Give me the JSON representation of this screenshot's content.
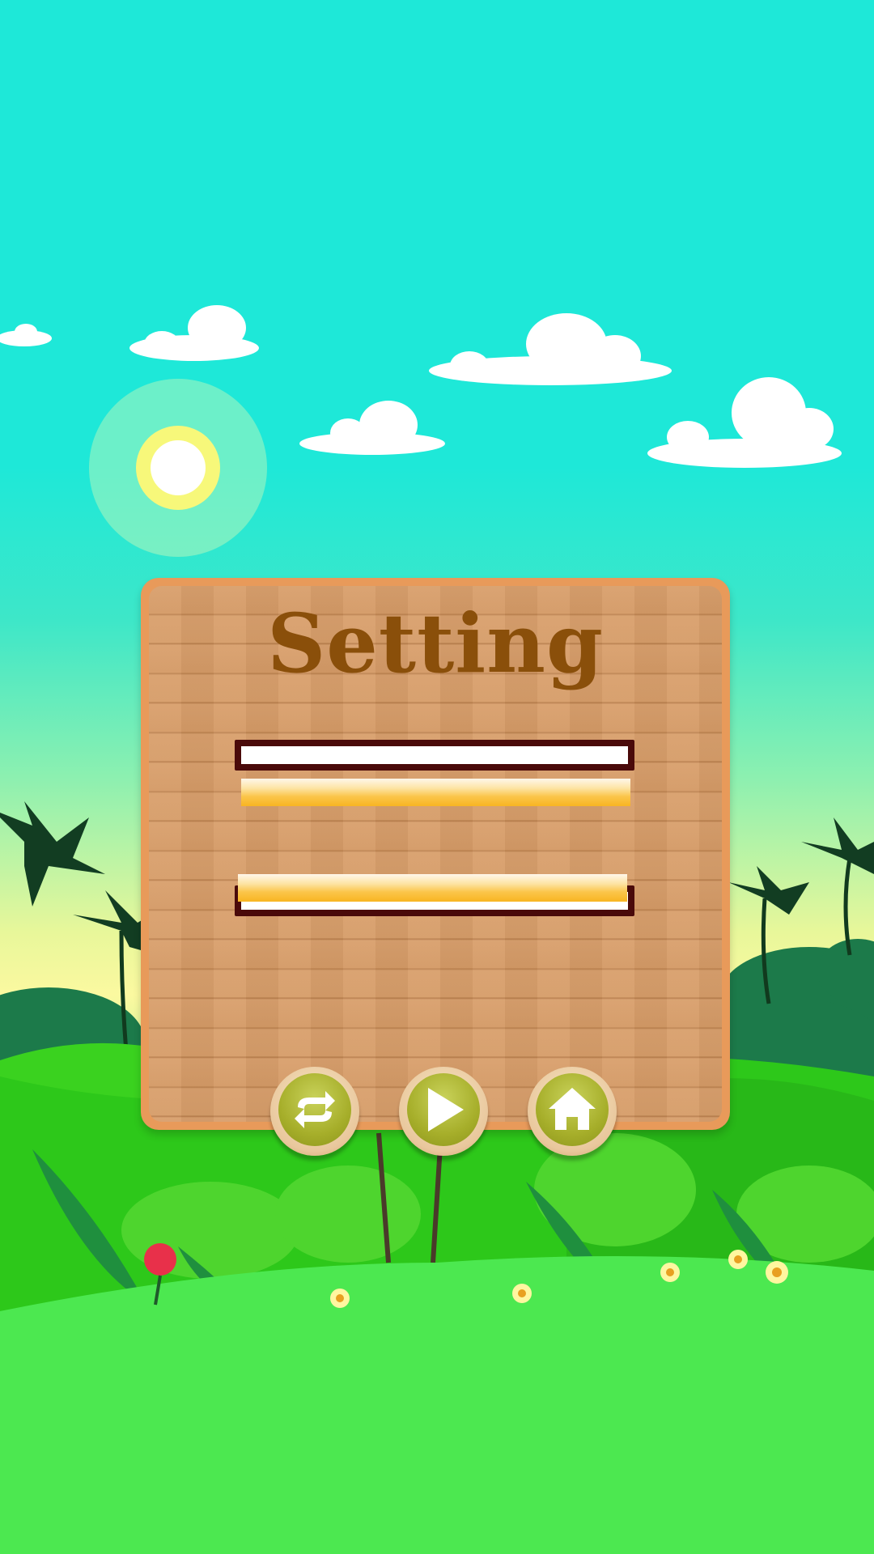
{
  "screen": {
    "title": "Setting"
  },
  "sliders": [
    {
      "name": "slider-1",
      "level": 0.99
    },
    {
      "name": "slider-2",
      "level": 0.99
    }
  ],
  "buttons": [
    {
      "name": "restart-button",
      "icon": "repeat-icon"
    },
    {
      "name": "play-button",
      "icon": "play-icon"
    },
    {
      "name": "home-button",
      "icon": "home-icon"
    }
  ],
  "colors": {
    "sky": "#1ee8d8",
    "grass": "#4ce850",
    "panel_border": "#e89a5a",
    "title": "#8a4f0a",
    "button_green": "#a6ae2a"
  }
}
